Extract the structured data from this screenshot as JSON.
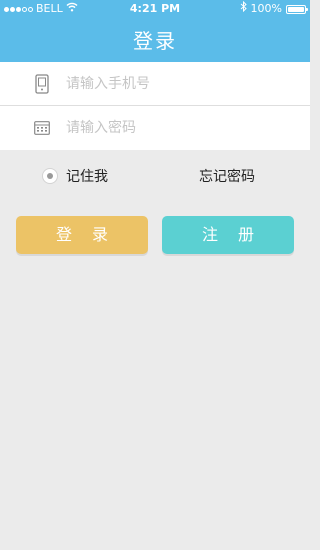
{
  "status_bar": {
    "carrier": "BELL",
    "time": "4:21 PM",
    "battery": "100%",
    "battery_level": 1.0,
    "signal_bars_filled": 3,
    "signal_bars_total": 5
  },
  "header": {
    "title": "登录"
  },
  "form": {
    "phone_placeholder": "请输入手机号",
    "password_placeholder": "请输入密码",
    "phone_icon": "phone-icon",
    "password_icon": "keypad-icon"
  },
  "options": {
    "remember_label": "记住我",
    "forgot_label": "忘记密码"
  },
  "buttons": {
    "login_label": "登录",
    "register_label": "注册"
  },
  "colors": {
    "header": "#5bbce9",
    "login_button": "#ecc366",
    "register_button": "#5bd0d2",
    "background": "#ebebeb"
  }
}
